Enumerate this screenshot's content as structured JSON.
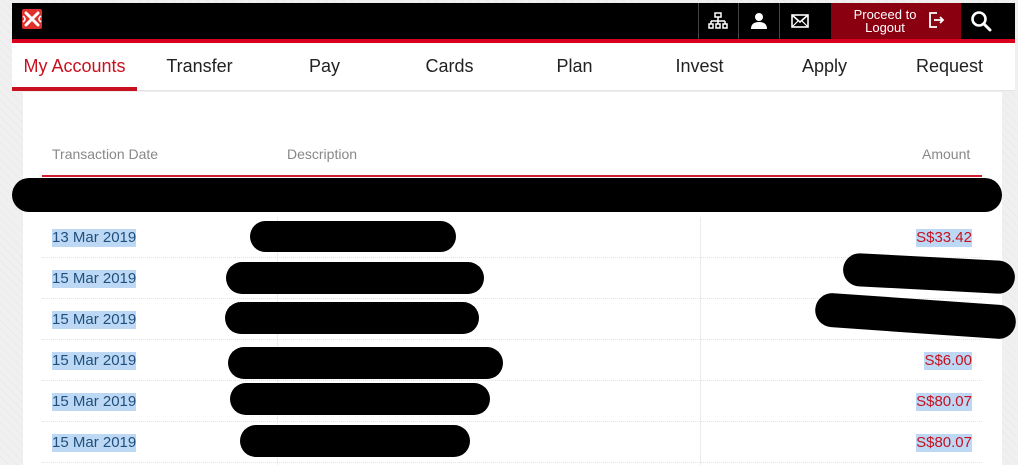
{
  "topbar": {
    "logo_icon": "bank-logo-icon",
    "icons": [
      "sitemap-icon",
      "profile-icon",
      "mail-icon"
    ],
    "logout_label": "Proceed to Logout",
    "search_icon": "search-icon",
    "brand_color": "#d8001c"
  },
  "nav": {
    "items": [
      {
        "label": "My Accounts",
        "active": true
      },
      {
        "label": "Transfer"
      },
      {
        "label": "Pay"
      },
      {
        "label": "Cards"
      },
      {
        "label": "Plan"
      },
      {
        "label": "Invest"
      },
      {
        "label": "Apply"
      },
      {
        "label": "Request"
      }
    ]
  },
  "table": {
    "headers": {
      "date": "Transaction Date",
      "description": "Description",
      "amount": "Amount"
    },
    "rows": [
      {
        "date": "13 Mar 2019",
        "amount": "S$33.42"
      },
      {
        "date": "15 Mar 2019",
        "amount": ""
      },
      {
        "date": "15 Mar 2019",
        "amount": ""
      },
      {
        "date": "15 Mar 2019",
        "amount": "S$6.00"
      },
      {
        "date": "15 Mar 2019",
        "amount": "S$80.07"
      },
      {
        "date": "15 Mar 2019",
        "amount": "S$80.07"
      }
    ]
  }
}
